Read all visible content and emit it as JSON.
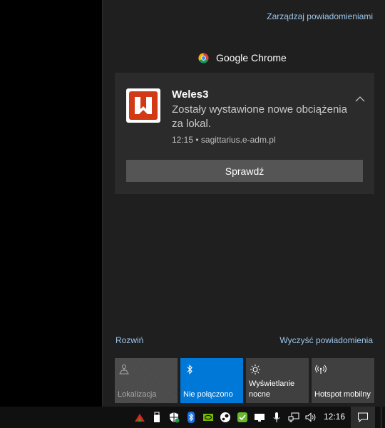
{
  "action_center": {
    "manage_link": "Zarządzaj powiadomieniami",
    "app_name": "Google Chrome",
    "expand_link": "Rozwiń",
    "clear_link": "Wyczyść powiadomienia"
  },
  "notification": {
    "title": "Weles3",
    "body": "Zostały wystawione nowe obciążenia za lokal.",
    "meta": "12:15 • sagittarius.e-adm.pl",
    "button_label": "Sprawdź",
    "logo_icon": "weles-logo-icon"
  },
  "quick_actions": [
    {
      "label": "Lokalizacja",
      "icon": "location-icon",
      "active": false,
      "disabled": true
    },
    {
      "label": "Nie połączono",
      "icon": "bluetooth-icon",
      "active": true
    },
    {
      "label": "Wyświetlanie nocne",
      "icon": "night-light-icon",
      "active": false
    },
    {
      "label": "Hotspot mobilny",
      "icon": "hotspot-icon",
      "active": false
    }
  ],
  "taskbar": {
    "clock": "12:16",
    "tray_icons": [
      "red-triangle-icon",
      "usb-drive-icon",
      "security-shield-icon",
      "bluetooth-icon",
      "nvidia-icon",
      "steam-icon",
      "green-check-icon",
      "display-icon",
      "microphone-icon",
      "network-icon",
      "volume-icon"
    ]
  },
  "colors": {
    "panel_bg": "#1f1f1f",
    "toast_bg": "#2b2b2b",
    "accent": "#0078d7",
    "link": "#9cc6ec",
    "tile_bg": "#404040"
  }
}
